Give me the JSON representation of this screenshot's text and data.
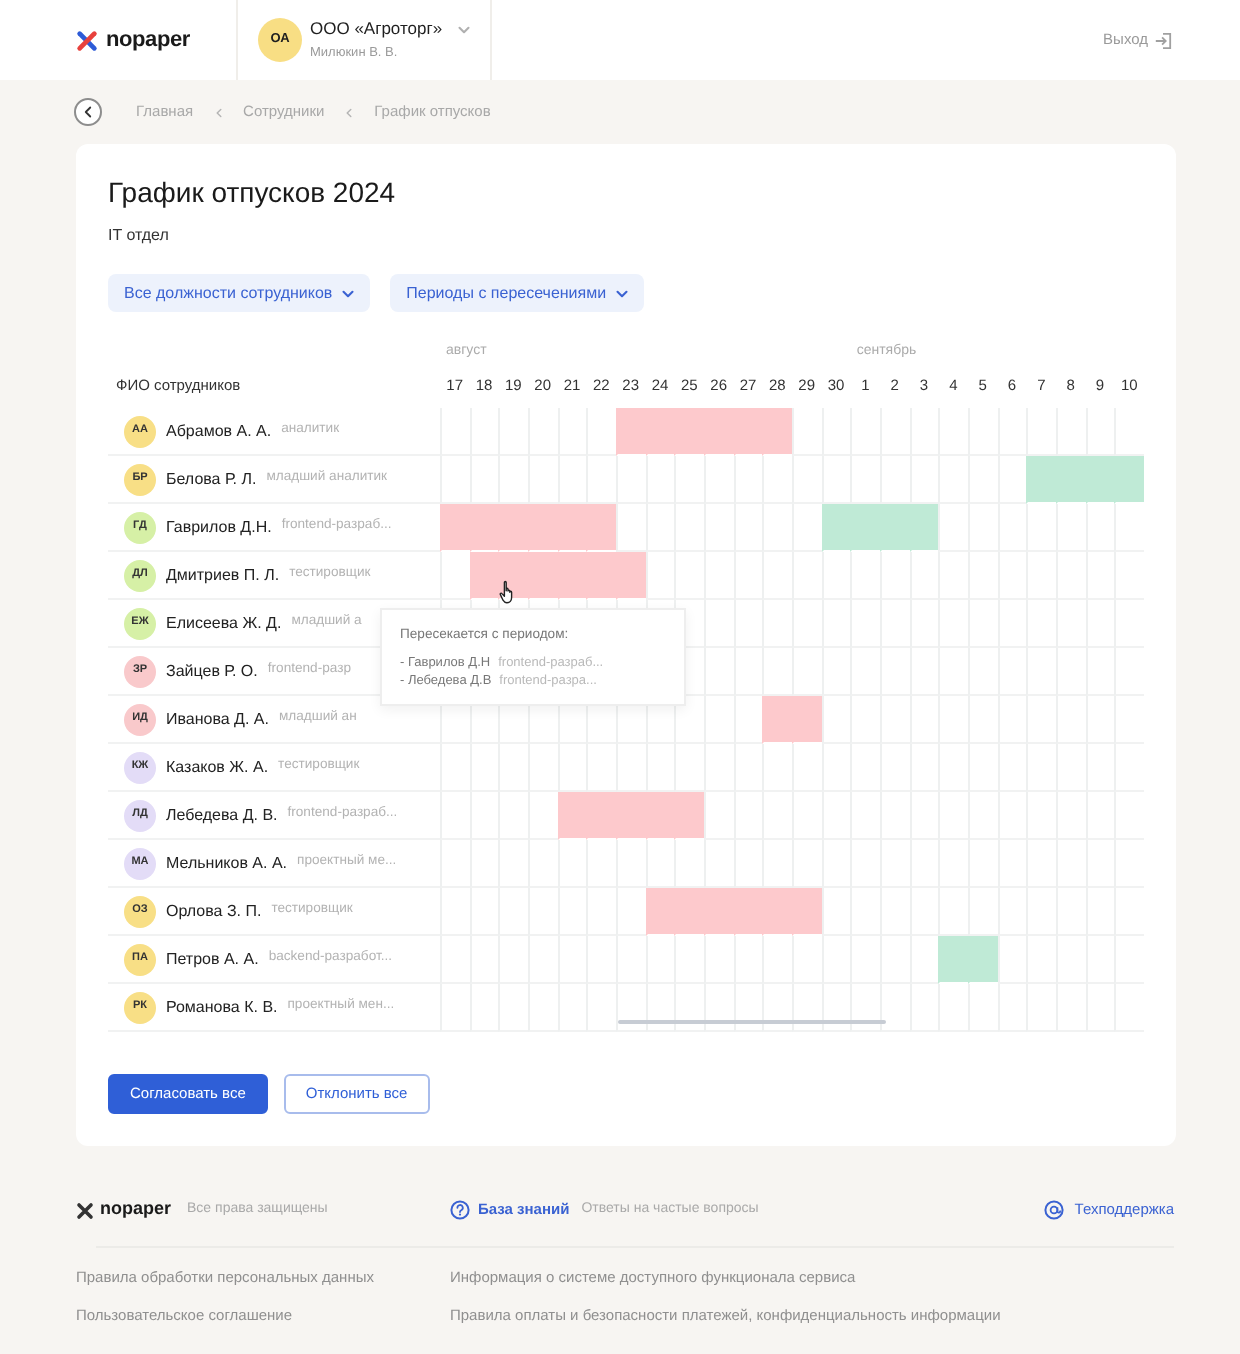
{
  "header": {
    "logo": "nopaper",
    "company": {
      "initials": "ОА",
      "name": "ООО «Агроторг»",
      "user": "Милюкин В. В."
    },
    "logout": "Выход"
  },
  "breadcrumbs": [
    "Главная",
    "Сотрудники",
    "График отпусков"
  ],
  "page": {
    "title": "График отпусков 2024",
    "department": "IT отдел",
    "filters": [
      "Все должности сотрудников",
      "Периоды с пересечениями"
    ]
  },
  "schedule": {
    "name_column": "ФИО сотрудников",
    "months": [
      {
        "name": "август",
        "days": [
          "17",
          "18",
          "19",
          "20",
          "21",
          "22",
          "23",
          "24",
          "25",
          "26",
          "27",
          "28",
          "29",
          "30"
        ]
      },
      {
        "name": "сентябрь",
        "days": [
          "1",
          "2",
          "3",
          "4",
          "5",
          "6",
          "7",
          "8",
          "9",
          "10"
        ]
      }
    ],
    "employees": [
      {
        "initials": "АА",
        "color": "#f8df86",
        "name": "Абрамов А. А.",
        "role": "аналитик",
        "days": [
          {
            "vacation": false
          },
          {
            "vacation": false
          },
          {
            "vacation": false
          },
          {
            "vacation": false
          },
          {
            "vacation": false
          },
          {
            "vacation": false
          },
          {
            "vacation": true,
            "overlap": true
          },
          {
            "vacation": true,
            "overlap": true
          },
          {
            "vacation": true,
            "overlap": true
          },
          {
            "vacation": true,
            "overlap": true
          },
          {
            "vacation": true,
            "overlap": true
          },
          {
            "vacation": true,
            "overlap": true
          },
          {
            "vacation": false
          },
          {
            "vacation": false
          },
          {
            "vacation": false
          },
          {
            "vacation": false
          },
          {
            "vacation": false
          },
          {
            "vacation": false
          },
          {
            "vacation": false
          },
          {
            "vacation": false
          },
          {
            "vacation": false
          },
          {
            "vacation": false
          },
          {
            "vacation": false
          },
          {
            "vacation": false
          }
        ]
      },
      {
        "initials": "БР",
        "color": "#f8df86",
        "name": "Белова Р. Л.",
        "role": "младший аналитик",
        "days": [
          {
            "vacation": false
          },
          {
            "vacation": false
          },
          {
            "vacation": false
          },
          {
            "vacation": false
          },
          {
            "vacation": false
          },
          {
            "vacation": false
          },
          {
            "vacation": false
          },
          {
            "vacation": false
          },
          {
            "vacation": false
          },
          {
            "vacation": false
          },
          {
            "vacation": false
          },
          {
            "vacation": false
          },
          {
            "vacation": false
          },
          {
            "vacation": false
          },
          {
            "vacation": false
          },
          {
            "vacation": false
          },
          {
            "vacation": false
          },
          {
            "vacation": false
          },
          {
            "vacation": false
          },
          {
            "vacation": false
          },
          {
            "vacation": true,
            "overlap": false
          },
          {
            "vacation": true,
            "overlap": false
          },
          {
            "vacation": true,
            "overlap": false
          },
          {
            "vacation": true,
            "overlap": false
          }
        ]
      },
      {
        "initials": "ГД",
        "color": "#d6f0a6",
        "name": "Гаврилов Д.Н.",
        "role": "frontend-разраб...",
        "days": [
          {
            "vacation": true,
            "overlap": true
          },
          {
            "vacation": true,
            "overlap": true
          },
          {
            "vacation": true,
            "overlap": true
          },
          {
            "vacation": true,
            "overlap": true
          },
          {
            "vacation": true,
            "overlap": true
          },
          {
            "vacation": true,
            "overlap": true
          },
          {
            "vacation": false
          },
          {
            "vacation": false
          },
          {
            "vacation": false
          },
          {
            "vacation": false
          },
          {
            "vacation": false
          },
          {
            "vacation": false
          },
          {
            "vacation": false
          },
          {
            "vacation": true,
            "overlap": false
          },
          {
            "vacation": true,
            "overlap": false
          },
          {
            "vacation": true,
            "overlap": false
          },
          {
            "vacation": true,
            "overlap": false
          },
          {
            "vacation": false
          },
          {
            "vacation": false
          },
          {
            "vacation": false
          },
          {
            "vacation": false
          },
          {
            "vacation": false
          },
          {
            "vacation": false
          },
          {
            "vacation": false
          }
        ]
      },
      {
        "initials": "ДЛ",
        "color": "#d6f0a6",
        "name": "Дмитриев П. Л.",
        "role": "тестировщик",
        "days": [
          {
            "vacation": false
          },
          {
            "vacation": true,
            "overlap": true
          },
          {
            "vacation": true,
            "overlap": true
          },
          {
            "vacation": true,
            "overlap": true
          },
          {
            "vacation": true,
            "overlap": true
          },
          {
            "vacation": true,
            "overlap": true
          },
          {
            "vacation": true,
            "overlap": true
          },
          {
            "vacation": false
          },
          {
            "vacation": false
          },
          {
            "vacation": false
          },
          {
            "vacation": false
          },
          {
            "vacation": false
          },
          {
            "vacation": false
          },
          {
            "vacation": false
          },
          {
            "vacation": false
          },
          {
            "vacation": false
          },
          {
            "vacation": false
          },
          {
            "vacation": false
          },
          {
            "vacation": false
          },
          {
            "vacation": false
          },
          {
            "vacation": false
          },
          {
            "vacation": false
          },
          {
            "vacation": false
          },
          {
            "vacation": false
          }
        ],
        "tooltip": {
          "title": "Пересекается с периодом:",
          "items": [
            {
              "name": "- Гаврилов Д.Н",
              "role": "frontend-разраб..."
            },
            {
              "name": "- Лебедева Д.В",
              "role": "frontend-разра..."
            }
          ]
        }
      },
      {
        "initials": "ЕЖ",
        "color": "#d6f0a6",
        "name": "Елисеева Ж. Д.",
        "role": "младший а",
        "days": [
          {
            "vacation": false
          },
          {
            "vacation": false
          },
          {
            "vacation": false
          },
          {
            "vacation": false
          },
          {
            "vacation": false
          },
          {
            "vacation": false
          },
          {
            "vacation": false
          },
          {
            "vacation": false
          },
          {
            "vacation": false
          },
          {
            "vacation": false
          },
          {
            "vacation": false
          },
          {
            "vacation": false
          },
          {
            "vacation": false
          },
          {
            "vacation": false
          },
          {
            "vacation": false
          },
          {
            "vacation": false
          },
          {
            "vacation": false
          },
          {
            "vacation": false
          },
          {
            "vacation": false
          },
          {
            "vacation": false
          },
          {
            "vacation": false
          },
          {
            "vacation": false
          },
          {
            "vacation": false
          },
          {
            "vacation": false
          }
        ]
      },
      {
        "initials": "ЗР",
        "color": "#f9c9cb",
        "name": "Зайцев Р. О.",
        "role": "frontend-разр",
        "days": [
          {
            "vacation": false
          },
          {
            "vacation": false
          },
          {
            "vacation": false
          },
          {
            "vacation": false
          },
          {
            "vacation": false
          },
          {
            "vacation": false
          },
          {
            "vacation": false
          },
          {
            "vacation": false
          },
          {
            "vacation": false
          },
          {
            "vacation": false
          },
          {
            "vacation": false
          },
          {
            "vacation": false
          },
          {
            "vacation": false
          },
          {
            "vacation": false
          },
          {
            "vacation": false
          },
          {
            "vacation": false
          }
        ]
      },
      {
        "initials": "ИД",
        "color": "#f9c9cb",
        "name": "Иванова Д. А.",
        "role": "младший ан",
        "days": [
          {
            "vacation": false
          },
          {
            "vacation": false
          },
          {
            "vacation": false
          },
          {
            "vacation": false
          },
          {
            "vacation": false
          },
          {
            "vacation": false
          },
          {
            "vacation": false
          },
          {
            "vacation": false
          },
          {
            "vacation": false
          },
          {
            "vacation": false
          },
          {
            "vacation": false
          },
          {
            "vacation": true,
            "overlap": true
          },
          {
            "vacation": true,
            "overlap": true
          },
          {
            "vacation": false
          },
          {
            "vacation": false
          },
          {
            "vacation": false
          },
          {
            "vacation": false
          },
          {
            "vacation": false
          },
          {
            "vacation": false
          },
          {
            "vacation": false
          },
          {
            "vacation": false
          },
          {
            "vacation": false
          },
          {
            "vacation": false
          },
          {
            "vacation": false
          }
        ]
      },
      {
        "initials": "КЖ",
        "color": "#e3dcf7",
        "name": "Казаков Ж. А.",
        "role": "тестировщик",
        "days": [
          {
            "vacation": false
          },
          {
            "vacation": false
          },
          {
            "vacation": false
          },
          {
            "vacation": false
          },
          {
            "vacation": false
          },
          {
            "vacation": false
          },
          {
            "vacation": false
          },
          {
            "vacation": false
          },
          {
            "vacation": false
          },
          {
            "vacation": false
          },
          {
            "vacation": false
          },
          {
            "vacation": false
          },
          {
            "vacation": false
          },
          {
            "vacation": false
          },
          {
            "vacation": false
          },
          {
            "vacation": false
          },
          {
            "vacation": false
          },
          {
            "vacation": false
          },
          {
            "vacation": false
          },
          {
            "vacation": false
          },
          {
            "vacation": false
          },
          {
            "vacation": false
          },
          {
            "vacation": false
          },
          {
            "vacation": false
          }
        ]
      },
      {
        "initials": "ЛД",
        "color": "#e3dcf7",
        "name": "Лебедева Д. В.",
        "role": "frontend-разраб...",
        "days": [
          {
            "vacation": false
          },
          {
            "vacation": false
          },
          {
            "vacation": false
          },
          {
            "vacation": false
          },
          {
            "vacation": true,
            "overlap": true
          },
          {
            "vacation": true,
            "overlap": true
          },
          {
            "vacation": true,
            "overlap": true
          },
          {
            "vacation": true,
            "overlap": true
          },
          {
            "vacation": true,
            "overlap": true
          },
          {
            "vacation": false
          },
          {
            "vacation": false
          },
          {
            "vacation": false
          },
          {
            "vacation": false
          },
          {
            "vacation": false
          },
          {
            "vacation": false
          },
          {
            "vacation": false
          },
          {
            "vacation": false
          },
          {
            "vacation": false
          },
          {
            "vacation": false
          },
          {
            "vacation": false
          },
          {
            "vacation": false
          },
          {
            "vacation": false
          },
          {
            "vacation": false
          },
          {
            "vacation": false
          }
        ]
      },
      {
        "initials": "МА",
        "color": "#e3dcf7",
        "name": "Мельников А. А.",
        "role": "проектный ме...",
        "days": [
          {
            "vacation": false
          },
          {
            "vacation": false
          },
          {
            "vacation": false
          },
          {
            "vacation": false
          },
          {
            "vacation": false
          },
          {
            "vacation": false
          },
          {
            "vacation": false
          },
          {
            "vacation": false
          },
          {
            "vacation": false
          },
          {
            "vacation": false
          },
          {
            "vacation": false
          },
          {
            "vacation": false
          },
          {
            "vacation": false
          },
          {
            "vacation": false
          },
          {
            "vacation": false
          },
          {
            "vacation": false
          },
          {
            "vacation": false
          },
          {
            "vacation": false
          },
          {
            "vacation": false
          },
          {
            "vacation": false
          },
          {
            "vacation": false
          },
          {
            "vacation": false
          },
          {
            "vacation": false
          },
          {
            "vacation": false
          }
        ]
      },
      {
        "initials": "ОЗ",
        "color": "#f8df86",
        "name": "Орлова З. П.",
        "role": "тестировщик",
        "days": [
          {
            "vacation": false
          },
          {
            "vacation": false
          },
          {
            "vacation": false
          },
          {
            "vacation": false
          },
          {
            "vacation": false
          },
          {
            "vacation": false
          },
          {
            "vacation": false
          },
          {
            "vacation": true,
            "overlap": true
          },
          {
            "vacation": true,
            "overlap": true
          },
          {
            "vacation": true,
            "overlap": true
          },
          {
            "vacation": true,
            "overlap": true
          },
          {
            "vacation": true,
            "overlap": true
          },
          {
            "vacation": true,
            "overlap": true
          },
          {
            "vacation": false
          },
          {
            "vacation": false
          },
          {
            "vacation": false
          },
          {
            "vacation": false
          },
          {
            "vacation": false
          },
          {
            "vacation": false
          },
          {
            "vacation": false
          },
          {
            "vacation": false
          },
          {
            "vacation": false
          },
          {
            "vacation": false
          },
          {
            "vacation": false
          }
        ]
      },
      {
        "initials": "ПА",
        "color": "#f8df86",
        "name": "Петров А. А.",
        "role": "backend-разработ...",
        "days": [
          {
            "vacation": false
          },
          {
            "vacation": false
          },
          {
            "vacation": false
          },
          {
            "vacation": false
          },
          {
            "vacation": false
          },
          {
            "vacation": false
          },
          {
            "vacation": false
          },
          {
            "vacation": false
          },
          {
            "vacation": false
          },
          {
            "vacation": false
          },
          {
            "vacation": false
          },
          {
            "vacation": false
          },
          {
            "vacation": false
          },
          {
            "vacation": false
          },
          {
            "vacation": false
          },
          {
            "vacation": false
          },
          {
            "vacation": false
          },
          {
            "vacation": true,
            "overlap": false
          },
          {
            "vacation": true,
            "overlap": false
          },
          {
            "vacation": false
          },
          {
            "vacation": false
          },
          {
            "vacation": false
          },
          {
            "vacation": false
          },
          {
            "vacation": false
          }
        ]
      },
      {
        "initials": "РК",
        "color": "#f8df86",
        "name": "Романова К. В.",
        "role": "проектный мен...",
        "days": [
          {
            "vacation": false
          },
          {
            "vacation": false
          },
          {
            "vacation": false
          },
          {
            "vacation": false
          },
          {
            "vacation": false
          },
          {
            "vacation": false
          },
          {
            "vacation": false
          },
          {
            "vacation": false
          },
          {
            "vacation": false
          },
          {
            "vacation": false
          },
          {
            "vacation": false
          },
          {
            "vacation": false
          },
          {
            "vacation": false
          },
          {
            "vacation": false
          },
          {
            "vacation": false
          },
          {
            "vacation": false
          },
          {
            "vacation": false
          },
          {
            "vacation": false
          },
          {
            "vacation": false
          },
          {
            "vacation": false
          },
          {
            "vacation": false
          },
          {
            "vacation": false
          },
          {
            "vacation": false
          },
          {
            "vacation": false
          }
        ]
      }
    ]
  },
  "actions": [
    {
      "label": "Согласовать все",
      "kind": "primary"
    },
    {
      "label": "Отклонить все",
      "kind": "outline"
    }
  ],
  "footer": {
    "logo": "nopaper",
    "rights": "Все права защищены",
    "help": {
      "title": "База знаний",
      "text": "Ответы на частые вопросы"
    },
    "support": "Техподдержка",
    "links": [
      "Правила обработки персональных данных",
      "Информация о системе доступного функционала сервиса",
      "Пользовательское соглашение",
      "Правила оплаты и безопасности платежей, конфиденциальность информации"
    ]
  }
}
